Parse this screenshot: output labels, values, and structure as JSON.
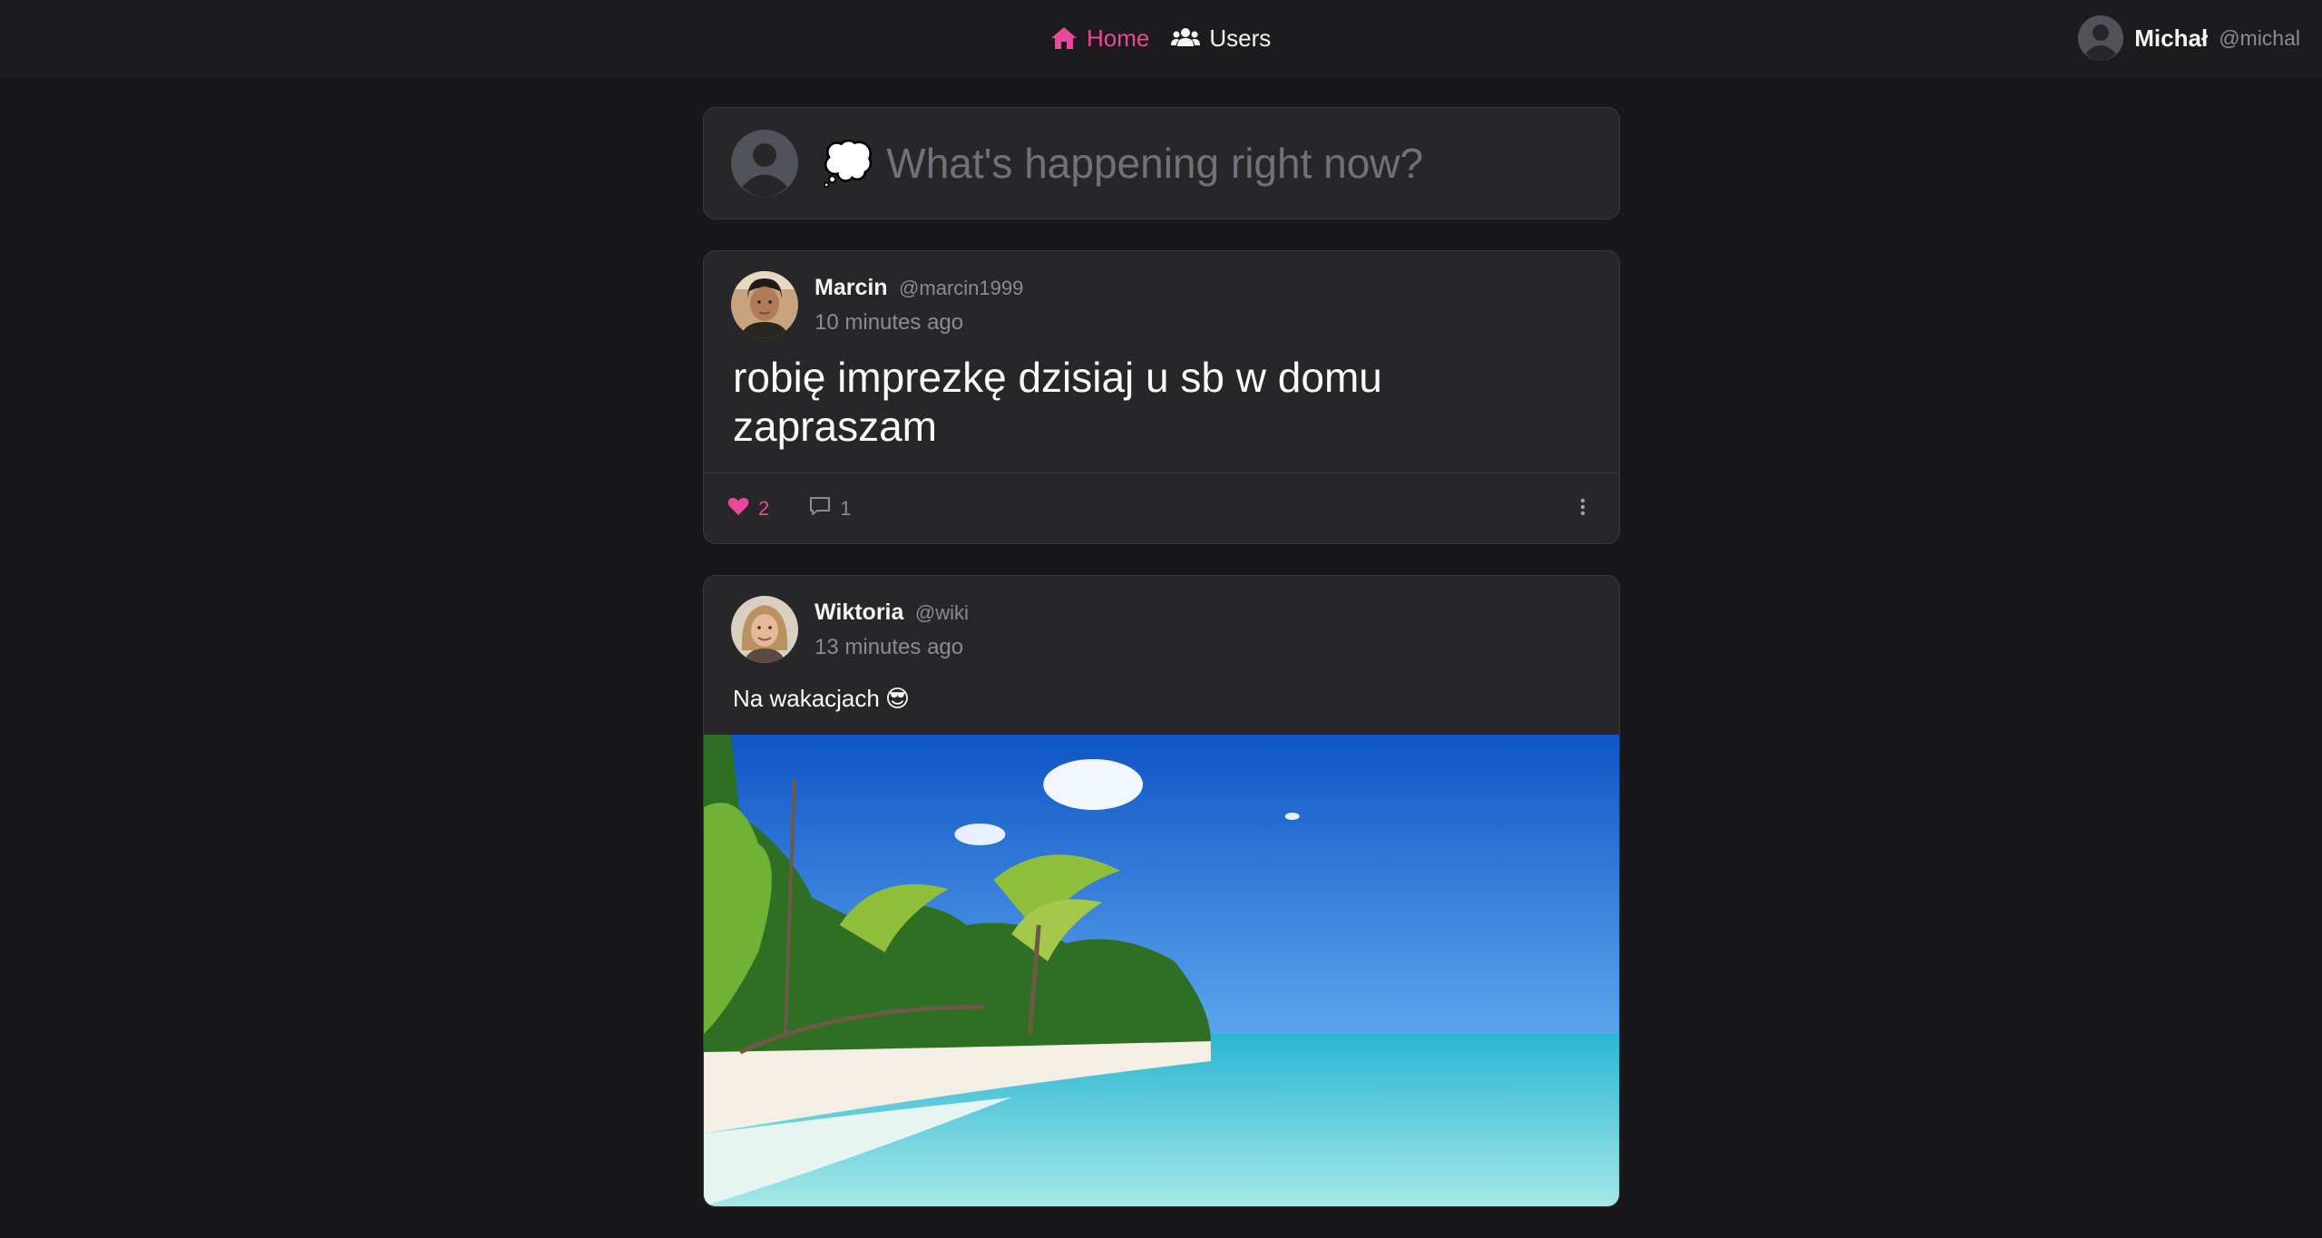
{
  "nav": {
    "home_label": "Home",
    "users_label": "Users",
    "active": "home",
    "accent": "#ec4899"
  },
  "current_user": {
    "name": "Michał",
    "handle": "@michal"
  },
  "composer": {
    "emoji": "💭",
    "placeholder": "What's happening right now?"
  },
  "posts": [
    {
      "author": "Marcin",
      "handle": "@marcin1999",
      "time": "10 minutes ago",
      "text": "robię imprezkę dzisiaj u sb w domu zapraszam",
      "likes": "2",
      "comments": "1",
      "liked": true
    },
    {
      "author": "Wiktoria",
      "handle": "@wiki",
      "time": "13 minutes ago",
      "text": "Na wakacjach",
      "emoji": "😎",
      "image": "beach-photo"
    }
  ]
}
